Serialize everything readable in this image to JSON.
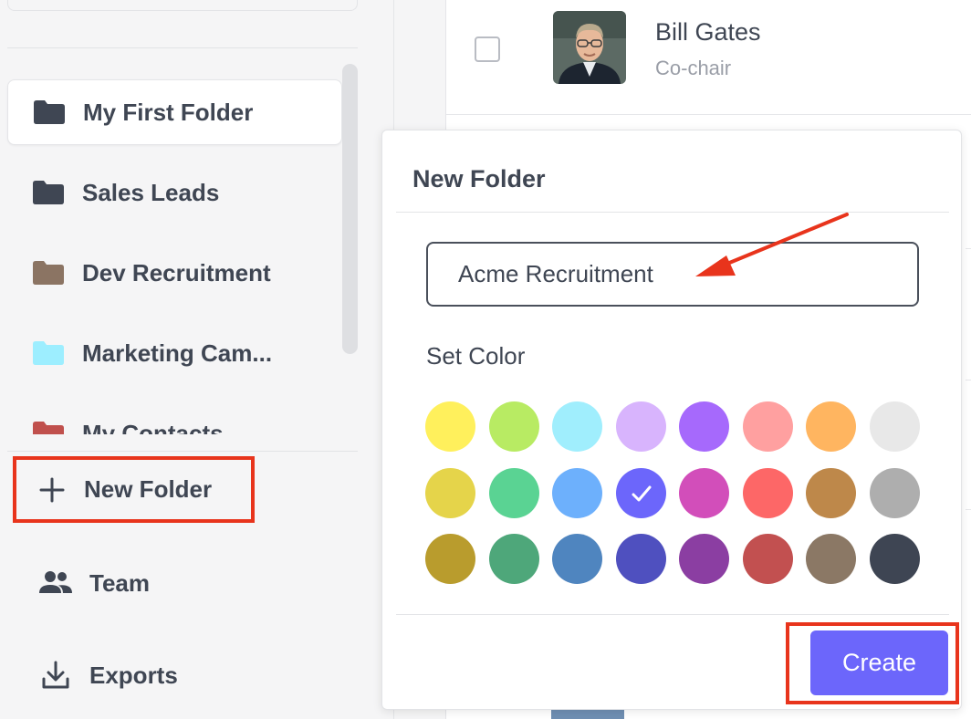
{
  "sidebar": {
    "folders": [
      {
        "label": "My First Folder",
        "color": "#3f4653",
        "active": true
      },
      {
        "label": "Sales Leads",
        "color": "#3f4653",
        "active": false
      },
      {
        "label": "Dev Recruitment",
        "color": "#8b7463",
        "active": false
      },
      {
        "label": "Marketing Cam...",
        "color": "#9deeff",
        "active": false
      },
      {
        "label": "My Contacts",
        "color": "#c0504d",
        "active": false
      }
    ],
    "new_folder_label": "New Folder",
    "nav": [
      {
        "label": "Team",
        "icon": "team-icon"
      },
      {
        "label": "Exports",
        "icon": "export-icon"
      }
    ]
  },
  "contact": {
    "name": "Bill Gates",
    "title": "Co-chair"
  },
  "modal": {
    "title": "New Folder",
    "input_value": "Acme Recruitment",
    "set_color_label": "Set Color",
    "selected_color": "#6c66fb",
    "colors": [
      [
        "#fff05c",
        "#b8eb63",
        "#a0eefd",
        "#d8b4fd",
        "#a669fc",
        "#ffa0a0",
        "#ffb560",
        "#e8e8e8"
      ],
      [
        "#e5d44a",
        "#5ad393",
        "#6db0fc",
        "#6c66fb",
        "#d24eba",
        "#fd6767",
        "#be884a",
        "#aeaeae"
      ],
      [
        "#b99c2d",
        "#4ea77a",
        "#4f85bf",
        "#4f50bf",
        "#8b3ea2",
        "#c25050",
        "#8b7865",
        "#3e4553"
      ]
    ],
    "create_label": "Create"
  },
  "annotations": {
    "highlight_color": "#e8341c"
  }
}
